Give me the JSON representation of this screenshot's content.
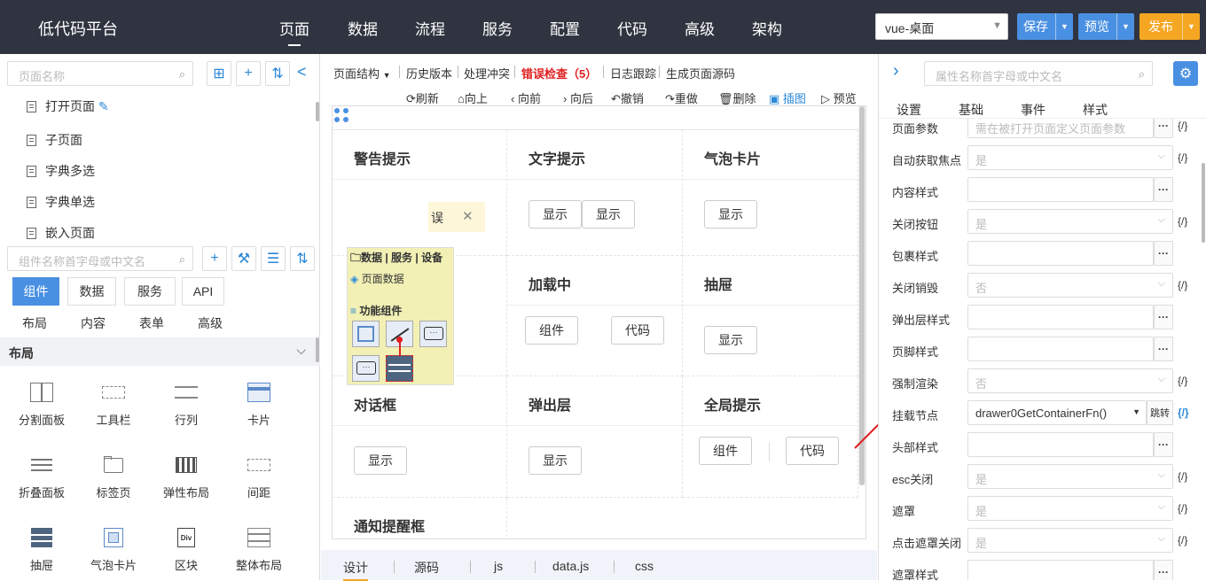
{
  "app": {
    "title": "低代码平台"
  },
  "topnav": [
    "页面",
    "数据",
    "流程",
    "服务",
    "配置",
    "代码",
    "高级",
    "架构"
  ],
  "env_select": {
    "value": "vue-桌面"
  },
  "actions": {
    "save": "保存",
    "preview": "预览",
    "publish": "发布"
  },
  "colors": {
    "topbar": "#2f3440",
    "accent": "#4a90e2",
    "publish": "#f5a623",
    "error": "#e02020"
  },
  "left": {
    "page_search_placeholder": "页面名称",
    "pages": [
      "打开页面",
      "子页面",
      "字典多选",
      "字典单选",
      "嵌入页面"
    ],
    "comp_search_placeholder": "组件名称首字母或中文名",
    "tabs": [
      "组件",
      "数据",
      "服务",
      "API"
    ],
    "subtabs": [
      "布局",
      "内容",
      "表单",
      "高级"
    ],
    "section": "布局",
    "components": [
      "分割面板",
      "工具栏",
      "行列",
      "卡片",
      "折叠面板",
      "标签页",
      "弹性布局",
      "间距",
      "抽屉",
      "气泡卡片",
      "区块",
      "整体布局"
    ]
  },
  "toolbar1": [
    "页面结构",
    "历史版本",
    "处理冲突",
    "错误检查（5）",
    "日志跟踪",
    "生成页面源码"
  ],
  "toolbar2": [
    "刷新",
    "向上",
    "向前",
    "向后",
    "撤销",
    "重做",
    "删除",
    "插图",
    "预览"
  ],
  "canvas": {
    "cells": [
      {
        "title": "警告提示"
      },
      {
        "title": "文字提示",
        "buttons": [
          "显示",
          "显示"
        ]
      },
      {
        "title": "气泡卡片",
        "buttons": [
          "显示"
        ]
      },
      {
        "title": "加载中",
        "buttons": [
          "组件",
          "代码"
        ]
      },
      {
        "title": "抽屉",
        "buttons": [
          "显示"
        ]
      },
      {
        "title": "对话框",
        "buttons": [
          "显示"
        ]
      },
      {
        "title": "弹出层",
        "buttons": [
          "显示"
        ]
      },
      {
        "title": "全局提示",
        "buttons": [
          "组件",
          "代码"
        ]
      },
      {
        "title": "通知提醒框"
      }
    ],
    "alert_tail": "误",
    "hidden_btn": "显示",
    "popup": {
      "header": "数据 | 服务 | 设备",
      "page_data": "页面数据",
      "func": "功能组件"
    }
  },
  "bottom_tabs": [
    "设计",
    "源码",
    "js",
    "data.js",
    "css"
  ],
  "right": {
    "search_placeholder": "属性名称首字母或中文名",
    "tabs": [
      "设置",
      "基础",
      "事件",
      "样式"
    ],
    "props": [
      {
        "label": "页面参数",
        "value": "需在被打开页面定义页面参数",
        "kind": "btn"
      },
      {
        "label": "自动获取焦点",
        "value": "是",
        "kind": "select"
      },
      {
        "label": "内容样式",
        "value": "",
        "kind": "btn"
      },
      {
        "label": "关闭按钮",
        "value": "是",
        "kind": "select"
      },
      {
        "label": "包裹样式",
        "value": "",
        "kind": "btn"
      },
      {
        "label": "关闭销毁",
        "value": "否",
        "kind": "select"
      },
      {
        "label": "弹出层样式",
        "value": "",
        "kind": "btn"
      },
      {
        "label": "页脚样式",
        "value": "",
        "kind": "btn"
      },
      {
        "label": "强制渲染",
        "value": "否",
        "kind": "select"
      },
      {
        "label": "挂载节点",
        "value": "drawer0GetContainerFn()",
        "kind": "jump"
      },
      {
        "label": "头部样式",
        "value": "",
        "kind": "btn"
      },
      {
        "label": "esc关闭",
        "value": "是",
        "kind": "select"
      },
      {
        "label": "遮罩",
        "value": "是",
        "kind": "select"
      },
      {
        "label": "点击遮罩关闭",
        "value": "是",
        "kind": "select"
      },
      {
        "label": "遮罩样式",
        "value": "",
        "kind": "btn"
      }
    ],
    "jump_label": "跳转",
    "fx": "{/}",
    "dots": "···"
  }
}
